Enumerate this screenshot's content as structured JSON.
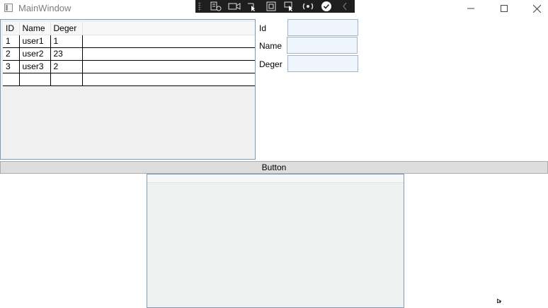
{
  "window": {
    "title": "MainWindow",
    "app_icon": "window-app-icon",
    "controls": [
      "minimize-icon",
      "maximize-icon",
      "close-icon"
    ]
  },
  "debug_toolbar": {
    "icons": [
      "live-visual-tree-icon",
      "record-icon",
      "select-element-icon",
      "display-layout-adorners-icon",
      "track-focused-element-icon",
      "hot-reload-icon",
      "binding-failures-icon",
      "collapse-chevron-icon"
    ],
    "background": "#1e1e1e"
  },
  "grid": {
    "columns": [
      "ID",
      "Name",
      "Deger"
    ],
    "rows": [
      [
        "1",
        "user1",
        "1"
      ],
      [
        "2",
        "user2",
        "23"
      ],
      [
        "3",
        "user3",
        "2"
      ],
      [
        "",
        "",
        ""
      ]
    ]
  },
  "form": {
    "id_label": "Id",
    "name_label": "Name",
    "deger_label": "Deger",
    "id_value": "",
    "name_value": "",
    "deger_value": ""
  },
  "button": {
    "label": "Button"
  },
  "colors": {
    "input_bg": "#eef5fd",
    "panel_bg": "#f0f0f0",
    "panel_border": "#7a9ab8",
    "button_bg": "#dddddd"
  }
}
